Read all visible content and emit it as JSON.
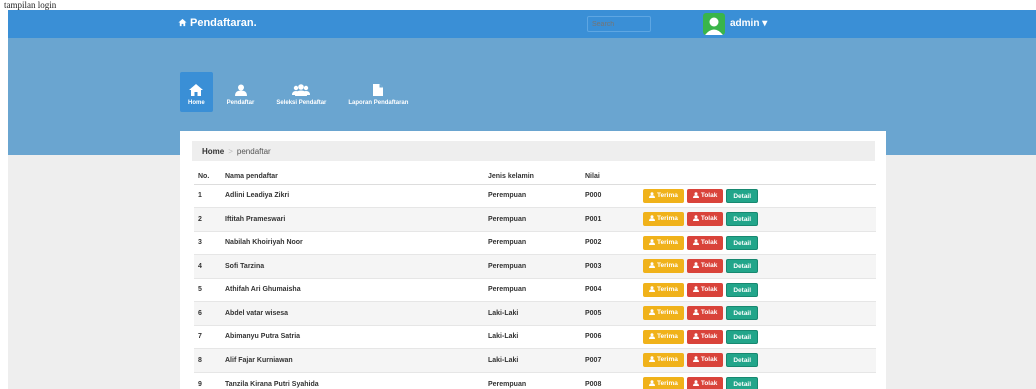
{
  "caption": "tampilan login",
  "navbar": {
    "brand": "Pendaftaran.",
    "search_placeholder": "Search",
    "user": "admin",
    "user_caret": "▾"
  },
  "nav": [
    {
      "label": "Home",
      "icon": "home-icon",
      "active": true
    },
    {
      "label": "Pendaftar",
      "icon": "user-icon",
      "active": false
    },
    {
      "label": "Seleksi Pendaftar",
      "icon": "users-icon",
      "active": false
    },
    {
      "label": "Laporan Pendaftaran",
      "icon": "document-icon",
      "active": false
    }
  ],
  "breadcrumb": {
    "home": "Home",
    "separator": ">",
    "current": "pendaftar"
  },
  "table": {
    "headers": {
      "no": "No.",
      "name": "Nama pendaftar",
      "gender": "Jenis kelamin",
      "score": "Nilai"
    },
    "actions": {
      "accept": "Terima",
      "reject": "Tolak",
      "detail": "Detail"
    },
    "rows": [
      {
        "no": "1",
        "name": "Adlini Leadiya Zikri",
        "gender": "Perempuan",
        "score": "P000"
      },
      {
        "no": "2",
        "name": "Iftitah Prameswari",
        "gender": "Perempuan",
        "score": "P001"
      },
      {
        "no": "3",
        "name": "Nabilah Khoiriyah Noor",
        "gender": "Perempuan",
        "score": "P002"
      },
      {
        "no": "4",
        "name": "Sofi Tarzina",
        "gender": "Perempuan",
        "score": "P003"
      },
      {
        "no": "5",
        "name": "Athifah Ari Ghumaisha",
        "gender": "Perempuan",
        "score": "P004"
      },
      {
        "no": "6",
        "name": "Abdel vatar wisesa",
        "gender": "Laki-Laki",
        "score": "P005"
      },
      {
        "no": "7",
        "name": "Abimanyu Putra Satria",
        "gender": "Laki-Laki",
        "score": "P006"
      },
      {
        "no": "8",
        "name": "Alif Fajar Kurniawan",
        "gender": "Laki-Laki",
        "score": "P007"
      },
      {
        "no": "9",
        "name": "Tanzila Kirana Putri Syahida",
        "gender": "Perempuan",
        "score": "P008"
      }
    ]
  },
  "colors": {
    "navbar": "#3a8fd6",
    "hero": "#6aa5d0",
    "accept": "#f0b21a",
    "reject": "#d9433a",
    "detail": "#22a58a",
    "avatar": "#39b54a"
  }
}
